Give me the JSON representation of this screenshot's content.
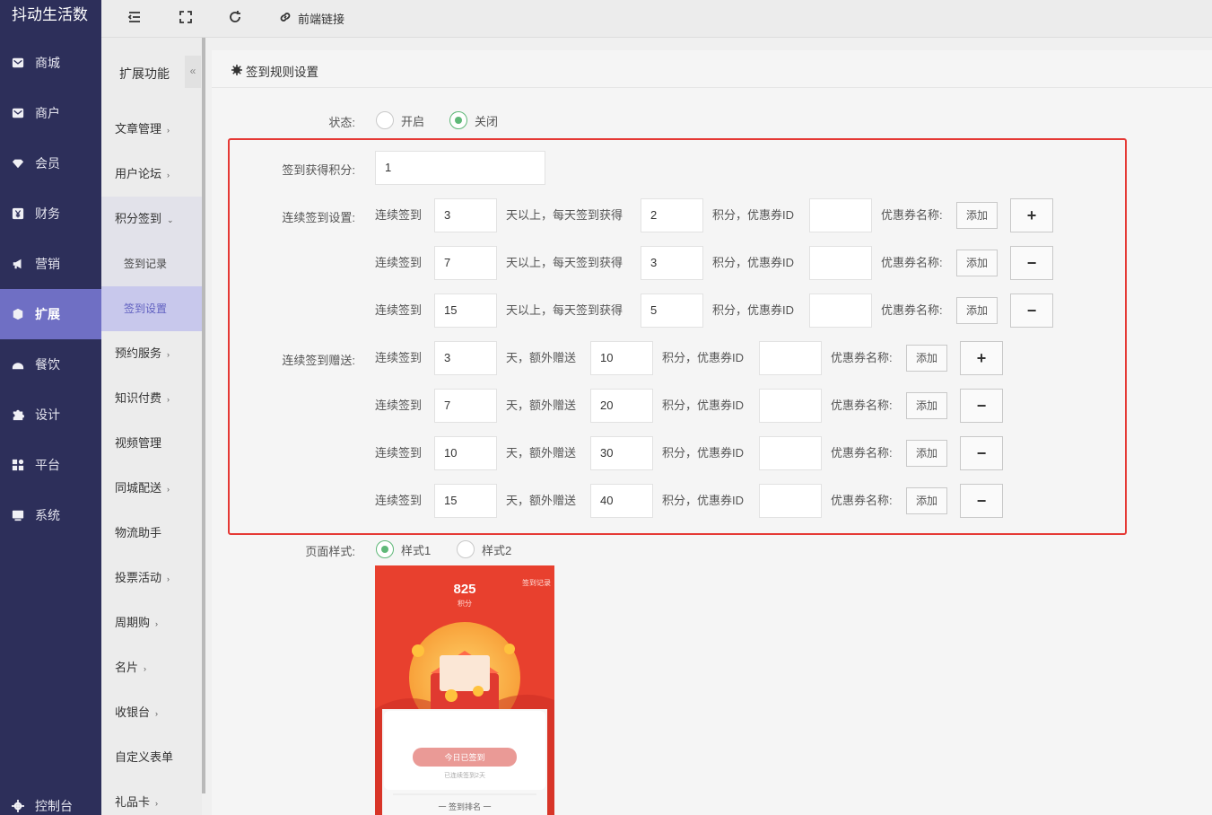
{
  "app": {
    "title": "抖动生活数"
  },
  "sidebar": {
    "items": [
      {
        "label": "商城",
        "icon": "mail-icon"
      },
      {
        "label": "商户",
        "icon": "mail-icon"
      },
      {
        "label": "会员",
        "icon": "diamond-icon"
      },
      {
        "label": "财务",
        "icon": "yen-icon"
      },
      {
        "label": "营销",
        "icon": "megaphone-icon"
      },
      {
        "label": "扩展",
        "icon": "cube-icon"
      },
      {
        "label": "餐饮",
        "icon": "cloud-icon"
      },
      {
        "label": "设计",
        "icon": "puzzle-icon"
      },
      {
        "label": "平台",
        "icon": "grid-icon"
      },
      {
        "label": "系统",
        "icon": "monitor-icon"
      },
      {
        "label": "控制台",
        "icon": "gear-icon"
      }
    ]
  },
  "submenu": {
    "title": "扩展功能",
    "collapse": "«",
    "items": [
      {
        "label": "文章管理",
        "arrow": "›"
      },
      {
        "label": "用户论坛",
        "arrow": "›"
      },
      {
        "label": "积分签到",
        "arrow": "⌄"
      },
      {
        "label": "签到记录"
      },
      {
        "label": "签到设置"
      },
      {
        "label": "预约服务",
        "arrow": "›"
      },
      {
        "label": "知识付费",
        "arrow": "›"
      },
      {
        "label": "视频管理"
      },
      {
        "label": "同城配送",
        "arrow": "›"
      },
      {
        "label": "物流助手"
      },
      {
        "label": "投票活动",
        "arrow": "›"
      },
      {
        "label": "周期购",
        "arrow": "›"
      },
      {
        "label": "名片",
        "arrow": "›"
      },
      {
        "label": "收银台",
        "arrow": "›"
      },
      {
        "label": "自定义表单"
      },
      {
        "label": "礼品卡",
        "arrow": "›"
      }
    ]
  },
  "topbar": {
    "link_label": "前端链接"
  },
  "panel": {
    "title": "签到规则设置"
  },
  "form": {
    "status": {
      "label": "状态:",
      "options": [
        "开启",
        "关闭"
      ],
      "selected": "关闭"
    },
    "points": {
      "label": "签到获得积分:",
      "value": "1"
    },
    "continuous": {
      "label": "连续签到设置:",
      "prefix": "连续签到",
      "mid": "天以上，每天签到获得",
      "suffix": "积分，优惠券ID",
      "coupon_name": "优惠券名称:",
      "add": "添加",
      "rows": [
        {
          "days": "3",
          "points": "2",
          "op": "+"
        },
        {
          "days": "7",
          "points": "3",
          "op": "−"
        },
        {
          "days": "15",
          "points": "5",
          "op": "−"
        }
      ]
    },
    "bonus": {
      "label": "连续签到赠送:",
      "prefix": "连续签到",
      "mid": "天，额外赠送",
      "suffix": "积分，优惠券ID",
      "coupon_name": "优惠券名称:",
      "add": "添加",
      "rows": [
        {
          "days": "3",
          "points": "10",
          "op": "+"
        },
        {
          "days": "7",
          "points": "20",
          "op": "−"
        },
        {
          "days": "10",
          "points": "30",
          "op": "−"
        },
        {
          "days": "15",
          "points": "40",
          "op": "−"
        }
      ]
    },
    "style": {
      "label": "页面样式:",
      "options": [
        "样式1",
        "样式2"
      ],
      "selected": "样式1"
    }
  },
  "preview": {
    "points": "825",
    "points_unit": "积分",
    "record_link": "签到记录",
    "sign_button": "今日已签到",
    "days_text": "已连续签到2天",
    "ranking": "一 签到排名 一"
  }
}
